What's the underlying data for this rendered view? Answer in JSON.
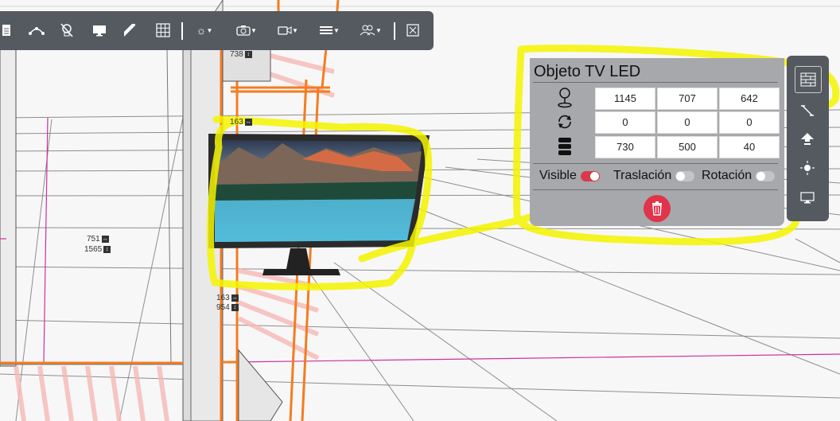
{
  "toolbar": {
    "buttons": [
      "document-icon",
      "curve-icon",
      "light-off-icon",
      "monitor-icon",
      "ruler-icon",
      "grid-icon",
      "sun-dropdown",
      "camera-dropdown",
      "video-dropdown",
      "menu-dropdown",
      "users-dropdown",
      "close-box-icon"
    ]
  },
  "dimensions": {
    "d1": "738",
    "d2": "163",
    "d3": "751",
    "d4": "1565",
    "d5": "163",
    "d6": "954"
  },
  "panel": {
    "title": "Objeto TV LED",
    "position": [
      "1145",
      "707",
      "642"
    ],
    "rotation": [
      "0",
      "0",
      "0"
    ],
    "size": [
      "730",
      "500",
      "40"
    ],
    "visible_label": "Visible",
    "translation_label": "Traslación",
    "rotation_label": "Rotación",
    "visible_on": true,
    "translation_on": false,
    "rotation_on": false
  },
  "colors": {
    "toolbar_bg": "#555a60",
    "panel_bg": "#a7a8ab",
    "highlight": "#f4f400",
    "delete": "#e0344a",
    "toggle_on": "#d73a4a",
    "toggle_off": "#c2c4c7",
    "orange": "#f47c20",
    "magenta": "#d12f9a"
  }
}
